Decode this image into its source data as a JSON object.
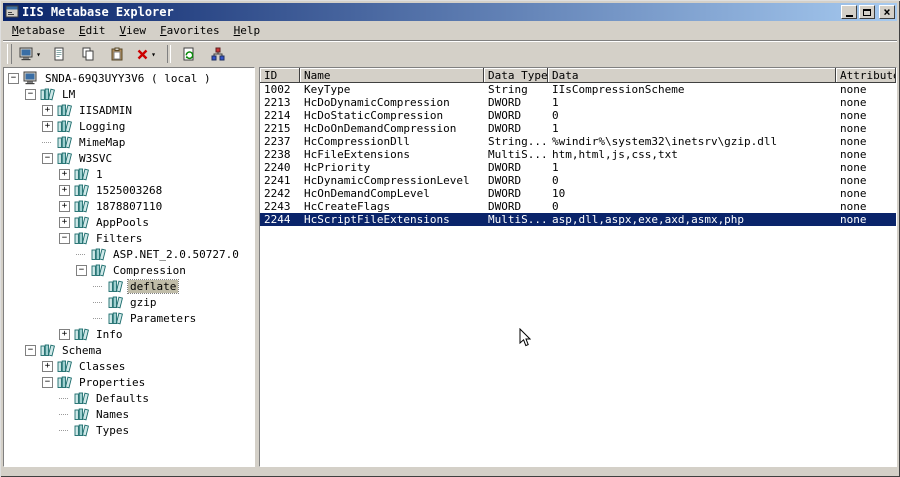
{
  "window": {
    "title": "IIS Metabase Explorer"
  },
  "menu": {
    "items": [
      {
        "label": "Metabase"
      },
      {
        "label": "Edit"
      },
      {
        "label": "View"
      },
      {
        "label": "Favorites"
      },
      {
        "label": "Help"
      }
    ]
  },
  "toolbar": {
    "items": [
      {
        "type": "button",
        "name": "connect-button",
        "icon": "computer-connect-icon",
        "dropdown": true
      },
      {
        "type": "button",
        "name": "new-key-button",
        "icon": "new-key-icon"
      },
      {
        "type": "button",
        "name": "copy-button",
        "icon": "copy-icon"
      },
      {
        "type": "button",
        "name": "paste-button",
        "icon": "paste-icon"
      },
      {
        "type": "button",
        "name": "delete-button",
        "icon": "delete-red-x-icon",
        "dropdown": true
      },
      {
        "type": "separator"
      },
      {
        "type": "button",
        "name": "export-button",
        "icon": "export-green-icon"
      },
      {
        "type": "button",
        "name": "permissions-button",
        "icon": "network-permissions-icon"
      }
    ]
  },
  "tree": {
    "nodes": [
      {
        "label": "SNDA-69Q3UYY3V6 ( local )",
        "level": 0,
        "expander": "-",
        "icon": "computer-icon",
        "selected": false
      },
      {
        "label": "LM",
        "level": 1,
        "expander": "-",
        "icon": "books-icon",
        "selected": false
      },
      {
        "label": "IISADMIN",
        "level": 2,
        "expander": "+",
        "icon": "books-icon",
        "selected": false
      },
      {
        "label": "Logging",
        "level": 2,
        "expander": "+",
        "icon": "books-icon",
        "selected": false
      },
      {
        "label": "MimeMap",
        "level": 2,
        "expander": null,
        "icon": "books-icon",
        "selected": false
      },
      {
        "label": "W3SVC",
        "level": 2,
        "expander": "-",
        "icon": "books-icon",
        "selected": false
      },
      {
        "label": "1",
        "level": 3,
        "expander": "+",
        "icon": "books-icon",
        "selected": false
      },
      {
        "label": "1525003268",
        "level": 3,
        "expander": "+",
        "icon": "books-icon",
        "selected": false
      },
      {
        "label": "1878807110",
        "level": 3,
        "expander": "+",
        "icon": "books-icon",
        "selected": false
      },
      {
        "label": "AppPools",
        "level": 3,
        "expander": "+",
        "icon": "books-icon",
        "selected": false
      },
      {
        "label": "Filters",
        "level": 3,
        "expander": "-",
        "icon": "books-icon",
        "selected": false
      },
      {
        "label": "ASP.NET_2.0.50727.0",
        "level": 4,
        "expander": null,
        "icon": "books-icon",
        "selected": false
      },
      {
        "label": "Compression",
        "level": 4,
        "expander": "-",
        "icon": "books-icon",
        "selected": false
      },
      {
        "label": "deflate",
        "level": 5,
        "expander": null,
        "icon": "books-icon",
        "selected": true
      },
      {
        "label": "gzip",
        "level": 5,
        "expander": null,
        "icon": "books-icon",
        "selected": false
      },
      {
        "label": "Parameters",
        "level": 5,
        "expander": null,
        "icon": "books-icon",
        "selected": false
      },
      {
        "label": "Info",
        "level": 3,
        "expander": "+",
        "icon": "books-icon",
        "selected": false
      },
      {
        "label": "Schema",
        "level": 1,
        "expander": "-",
        "icon": "books-icon",
        "selected": false
      },
      {
        "label": "Classes",
        "level": 2,
        "expander": "+",
        "icon": "books-icon",
        "selected": false
      },
      {
        "label": "Properties",
        "level": 2,
        "expander": "-",
        "icon": "books-icon",
        "selected": false
      },
      {
        "label": "Defaults",
        "level": 3,
        "expander": null,
        "icon": "books-icon",
        "selected": false
      },
      {
        "label": "Names",
        "level": 3,
        "expander": null,
        "icon": "books-icon",
        "selected": false
      },
      {
        "label": "Types",
        "level": 3,
        "expander": null,
        "icon": "books-icon",
        "selected": false
      }
    ]
  },
  "table": {
    "columns": [
      "ID",
      "Name",
      "Data Type",
      "Data",
      "Attributes"
    ],
    "rows": [
      {
        "id": "1002",
        "name": "KeyType",
        "type": "String",
        "data": "IIsCompressionScheme",
        "attributes": "none",
        "selected": false
      },
      {
        "id": "2213",
        "name": "HcDoDynamicCompression",
        "type": "DWORD",
        "data": "1",
        "attributes": "none",
        "selected": false
      },
      {
        "id": "2214",
        "name": "HcDoStaticCompression",
        "type": "DWORD",
        "data": "0",
        "attributes": "none",
        "selected": false
      },
      {
        "id": "2215",
        "name": "HcDoOnDemandCompression",
        "type": "DWORD",
        "data": "1",
        "attributes": "none",
        "selected": false
      },
      {
        "id": "2237",
        "name": "HcCompressionDll",
        "type": "String...",
        "data": "%windir%\\system32\\inetsrv\\gzip.dll",
        "attributes": "none",
        "selected": false
      },
      {
        "id": "2238",
        "name": "HcFileExtensions",
        "type": "MultiS...",
        "data": "htm,html,js,css,txt",
        "attributes": "none",
        "selected": false
      },
      {
        "id": "2240",
        "name": "HcPriority",
        "type": "DWORD",
        "data": "1",
        "attributes": "none",
        "selected": false
      },
      {
        "id": "2241",
        "name": "HcDynamicCompressionLevel",
        "type": "DWORD",
        "data": "0",
        "attributes": "none",
        "selected": false
      },
      {
        "id": "2242",
        "name": "HcOnDemandCompLevel",
        "type": "DWORD",
        "data": "10",
        "attributes": "none",
        "selected": false
      },
      {
        "id": "2243",
        "name": "HcCreateFlags",
        "type": "DWORD",
        "data": "0",
        "attributes": "none",
        "selected": false
      },
      {
        "id": "2244",
        "name": "HcScriptFileExtensions",
        "type": "MultiS...",
        "data": "asp,dll,aspx,exe,axd,asmx,php",
        "attributes": "none",
        "selected": true
      }
    ]
  },
  "colors": {
    "title_gradient_start": "#0a246a",
    "title_gradient_end": "#a6caf0",
    "selection": "#0a246a",
    "inactive_selection": "#c0bca8",
    "chrome": "#d4d0c8"
  }
}
